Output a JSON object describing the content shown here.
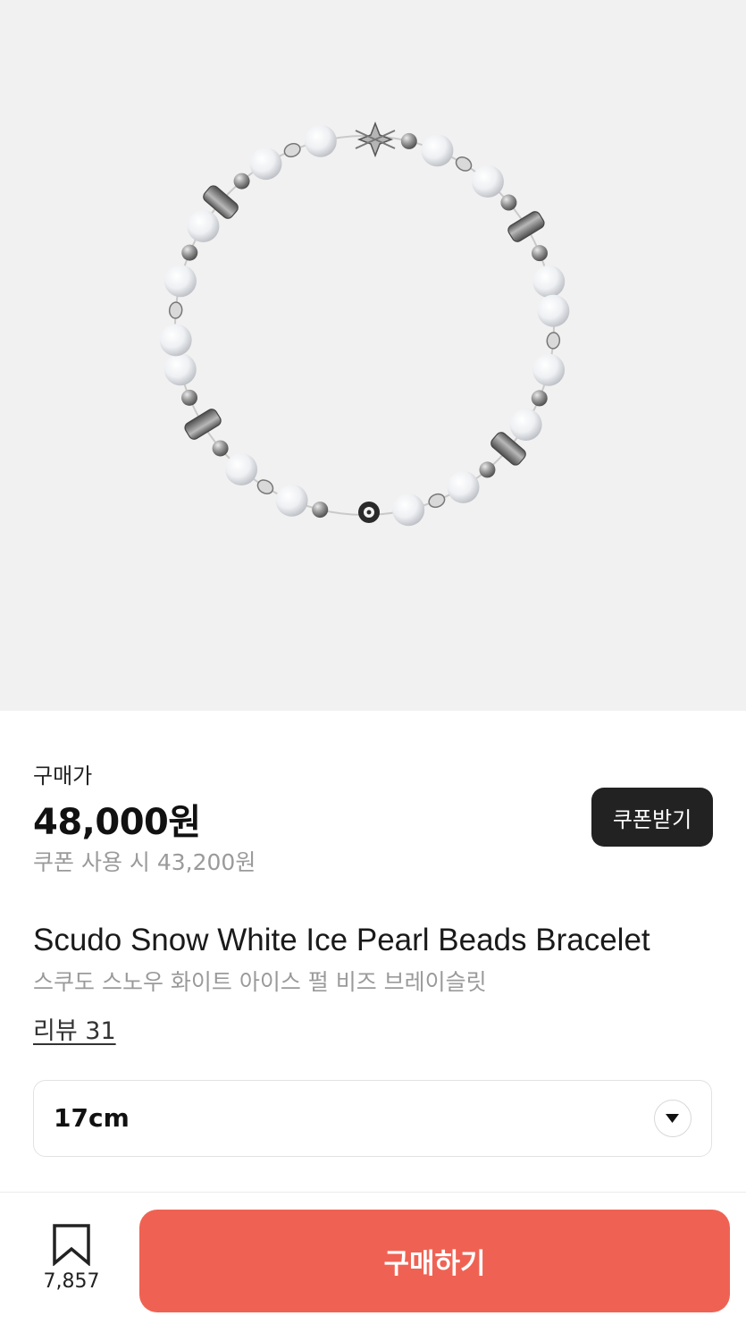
{
  "product": {
    "image_alt": "pearl beads bracelet",
    "price_label": "구매가",
    "price": "48,000원",
    "coupon_price": "쿠폰 사용 시 43,200원",
    "coupon_button": "쿠폰받기",
    "title_en": "Scudo Snow White Ice Pearl Beads Bracelet",
    "title_ko": "스쿠도 스노우 화이트 아이스 펄 비즈 브레이슬릿",
    "review_link": "리뷰 31"
  },
  "option": {
    "selected": "17cm",
    "icon": "chevron-down-icon"
  },
  "bottom_bar": {
    "bookmark_icon": "bookmark-icon",
    "bookmark_count": "7,857",
    "buy_button": "구매하기"
  },
  "colors": {
    "image_background": "#f1f1f1",
    "coupon_button": "#222222",
    "buy_button": "#ef6253",
    "muted_text": "#9a9a9a"
  }
}
